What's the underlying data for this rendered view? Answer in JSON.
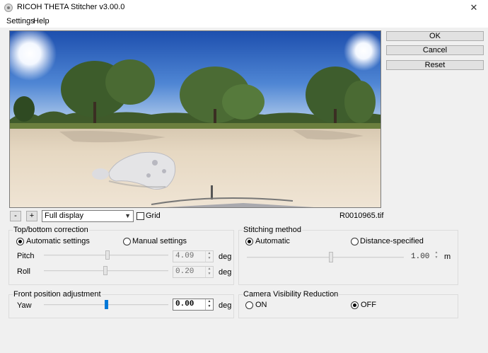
{
  "window": {
    "title": "RICOH THETA Stitcher v3.00.0",
    "close_glyph": "✕"
  },
  "menu": {
    "items": [
      "Settings",
      "Help"
    ]
  },
  "actions": {
    "ok": "OK",
    "cancel": "Cancel",
    "reset": "Reset"
  },
  "preview": {
    "zoom_out": "-",
    "zoom_in": "+",
    "display_mode": "Full display",
    "grid_label": "Grid",
    "grid_checked": false,
    "filename": "R0010965.tif"
  },
  "top_bottom": {
    "title": "Top/bottom correction",
    "auto_label": "Automatic settings",
    "manual_label": "Manual settings",
    "selected": "auto",
    "pitch_label": "Pitch",
    "pitch_value": "4.09",
    "pitch_unit": "deg",
    "roll_label": "Roll",
    "roll_value": "0.20",
    "roll_unit": "deg"
  },
  "front_position": {
    "title": "Front position adjustment",
    "yaw_label": "Yaw",
    "yaw_value": "0.00",
    "yaw_unit": "deg"
  },
  "stitching": {
    "title": "Stitching method",
    "auto_label": "Automatic",
    "distance_label": "Distance-specified",
    "selected": "auto",
    "distance_value": "1.00",
    "distance_unit": "m"
  },
  "camera_visibility": {
    "title": "Camera Visibility Reduction",
    "on_label": "ON",
    "off_label": "OFF",
    "selected": "off"
  },
  "colors": {
    "accent": "#0078d7",
    "sky_top": "#1f55b5",
    "sand": "#e8dccb"
  },
  "icons": {
    "app": "theta-app-icon",
    "close": "close-icon",
    "dropdown": "chevron-down-icon"
  }
}
